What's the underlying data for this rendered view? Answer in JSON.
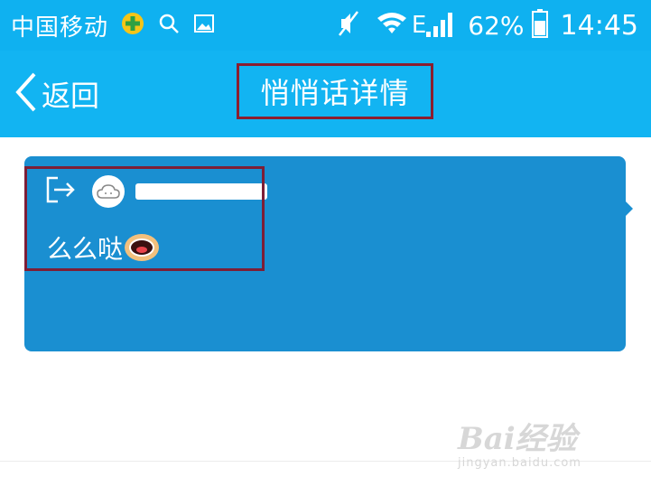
{
  "status_bar": {
    "carrier": "中国移动",
    "network_type": "E",
    "battery_percent": "62%",
    "time": "14:45"
  },
  "nav": {
    "back_label": "返回",
    "title": "悄悄话详情"
  },
  "message_card": {
    "message_text": "么么哒"
  },
  "watermark": {
    "brand": "Bai经验",
    "url": "jingyan.baidu.com"
  },
  "colors": {
    "status_bar_bg": "#0fb1f0",
    "nav_bg": "#12b4f2",
    "card_bg": "#1a8fd1",
    "highlight_border": "#8b1e2f"
  }
}
